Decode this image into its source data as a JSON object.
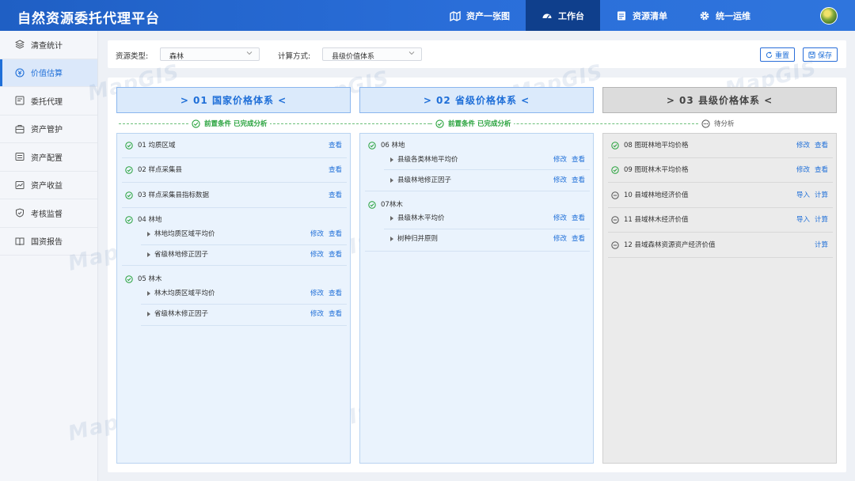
{
  "app": {
    "title": "自然资源委托代理平台"
  },
  "nav": [
    {
      "label": "资产一张图",
      "icon": "map-icon",
      "active": false
    },
    {
      "label": "工作台",
      "icon": "dashboard-icon",
      "active": true
    },
    {
      "label": "资源清单",
      "icon": "list-icon",
      "active": false
    },
    {
      "label": "统一运维",
      "icon": "gear-icon",
      "active": false
    }
  ],
  "sidebar": [
    {
      "label": "清查统计",
      "icon": "layers-icon"
    },
    {
      "label": "价值估算",
      "icon": "coin-icon",
      "active": true
    },
    {
      "label": "委托代理",
      "icon": "delegate-icon"
    },
    {
      "label": "资产管护",
      "icon": "briefcase-icon"
    },
    {
      "label": "资产配置",
      "icon": "config-icon"
    },
    {
      "label": "资产收益",
      "icon": "chart-icon"
    },
    {
      "label": "考核监督",
      "icon": "shield-check-icon"
    },
    {
      "label": "国资报告",
      "icon": "book-icon"
    }
  ],
  "filters": {
    "resource_type_label": "资源类型:",
    "resource_type_value": "森林",
    "calc_method_label": "计算方式:",
    "calc_method_value": "县级价值体系",
    "reset_label": "重置",
    "save_label": "保存"
  },
  "columns": [
    {
      "title": ">  01 国家价格体系  <",
      "status": "前置条件 已完成分析",
      "items": [
        {
          "label": "01 均质区域",
          "status": "done",
          "links": [
            "查看"
          ]
        },
        {
          "label": "02 样点采集县",
          "status": "done",
          "links": [
            "查看"
          ]
        },
        {
          "label": "03 样点采集县指标数据",
          "status": "done",
          "links": [
            "查看"
          ]
        },
        {
          "label": "04 林地",
          "status": "done",
          "links": [],
          "children": [
            {
              "label": "林地均质区域平均价",
              "links": [
                "修改",
                "查看"
              ]
            },
            {
              "label": "省级林地修正因子",
              "links": [
                "修改",
                "查看"
              ]
            }
          ]
        },
        {
          "label": "05 林木",
          "status": "done",
          "links": [],
          "children": [
            {
              "label": "林木均质区域平均价",
              "links": [
                "修改",
                "查看"
              ]
            },
            {
              "label": "省级林木修正因子",
              "links": [
                "修改",
                "查看"
              ]
            }
          ]
        }
      ]
    },
    {
      "title": ">  02 省级价格体系  <",
      "status": "前置条件 已完成分析",
      "items": [
        {
          "label": "06 林地",
          "status": "done",
          "links": [],
          "children": [
            {
              "label": "县级各类林地平均价",
              "links": [
                "修改",
                "查看"
              ]
            },
            {
              "label": "县级林地修正因子",
              "links": [
                "修改",
                "查看"
              ]
            }
          ]
        },
        {
          "label": "07林木",
          "status": "done",
          "links": [],
          "children": [
            {
              "label": "县级林木平均价",
              "links": [
                "修改",
                "查看"
              ]
            },
            {
              "label": "树种归并原则",
              "links": [
                "修改",
                "查看"
              ]
            }
          ]
        }
      ]
    },
    {
      "title": ">  03 县级价格体系  <",
      "status": "待分析",
      "items": [
        {
          "label": "08 图斑林地平均价格",
          "status": "done",
          "links": [
            "修改",
            "查看"
          ]
        },
        {
          "label": "09 图斑林木平均价格",
          "status": "done",
          "links": [
            "修改",
            "查看"
          ]
        },
        {
          "label": "10 县域林地经济价值",
          "status": "pending",
          "links": [
            "导入",
            "计算"
          ]
        },
        {
          "label": "11 县域林木经济价值",
          "status": "pending",
          "links": [
            "导入",
            "计算"
          ]
        },
        {
          "label": "12 县域森林资源资产经济价值",
          "status": "pending",
          "links": [
            "计算"
          ]
        }
      ]
    }
  ],
  "watermark": "MapGIS",
  "colors": {
    "primary": "#1f6fd8",
    "header": "#2a6ed9",
    "success": "#25a13a",
    "panel_blue": "#eaf3fd",
    "panel_gray": "#ebebeb"
  }
}
